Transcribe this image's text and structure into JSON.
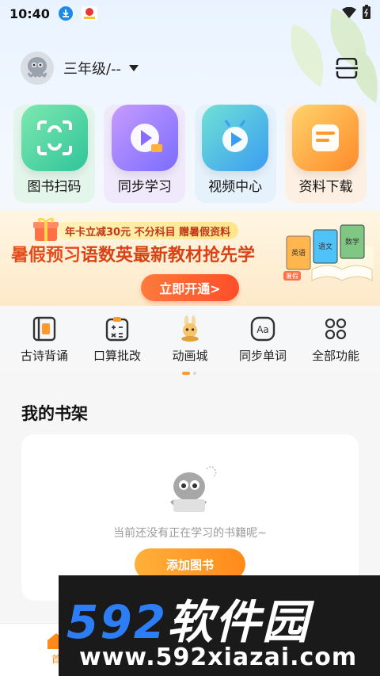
{
  "status_bar": {
    "time": "10:40",
    "icons": [
      "download-icon",
      "app-notification-icon",
      "wifi-icon",
      "battery-icon"
    ]
  },
  "header": {
    "grade_label": "三年级/--",
    "avatar_icon": "octopus-avatar-icon",
    "scan_icon": "scan-icon"
  },
  "main_tiles": [
    {
      "label": "图书扫码",
      "icon": "book-scan-icon"
    },
    {
      "label": "同步学习",
      "icon": "play-sync-icon"
    },
    {
      "label": "视频中心",
      "icon": "video-tv-icon"
    },
    {
      "label": "资料下载",
      "icon": "document-download-icon"
    }
  ],
  "banner": {
    "tag": "年卡立减30元  不分科目 赠暑假资料",
    "headline_a": "暑假预习",
    "headline_b": "语数英最新教材抢先学",
    "cta": "立即开通>",
    "book_labels": [
      "英语",
      "语文",
      "数学",
      "暑假"
    ]
  },
  "quick_functions": [
    {
      "label": "古诗背诵",
      "icon": "poem-book-icon"
    },
    {
      "label": "口算批改",
      "icon": "calculator-icon"
    },
    {
      "label": "动画城",
      "icon": "bunny-mascot-icon"
    },
    {
      "label": "同步单词",
      "icon": "word-aa-icon"
    },
    {
      "label": "全部功能",
      "icon": "grid-apps-icon"
    }
  ],
  "bookshelf": {
    "title": "我的书架",
    "empty_text": "当前还没有正在学习的书籍呢~",
    "add_button": "添加图书"
  },
  "bottom_nav": {
    "home_label": "首"
  },
  "watermark": {
    "brand": "592软件园",
    "url": "www.592xiazai.com"
  },
  "colors": {
    "accent": "#ff8a1a",
    "banner_red": "#e64a19",
    "wm_blue": "#2d7df6"
  }
}
